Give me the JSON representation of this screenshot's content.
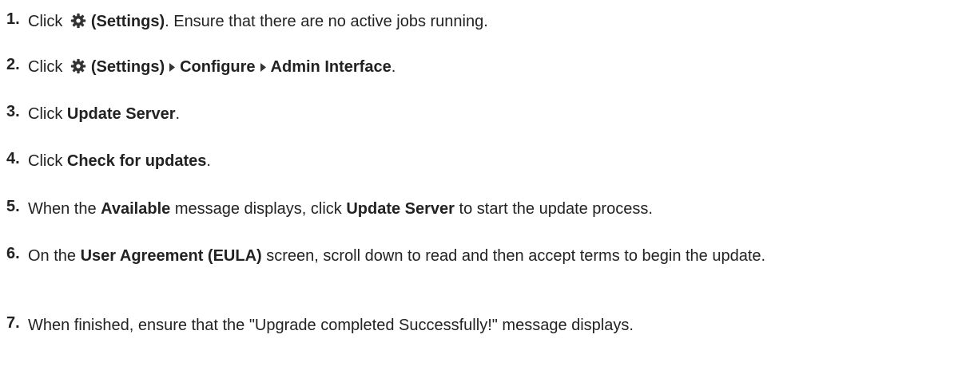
{
  "steps": [
    {
      "number": "1.",
      "runs": [
        {
          "t": "Click ",
          "b": false
        },
        {
          "icon": "gear-icon"
        },
        {
          "t": "(Settings)",
          "b": true
        },
        {
          "t": ". Ensure that there are no active jobs running.",
          "b": false
        }
      ]
    },
    {
      "number": "2.",
      "runs": [
        {
          "t": "Click ",
          "b": false
        },
        {
          "icon": "gear-icon"
        },
        {
          "t": "(Settings)",
          "b": true
        },
        {
          "icon": "caret-right-icon"
        },
        {
          "t": "Configure",
          "b": true
        },
        {
          "icon": "caret-right-icon"
        },
        {
          "t": "Admin Interface",
          "b": true
        },
        {
          "t": ".",
          "b": false
        }
      ]
    },
    {
      "number": "3.",
      "runs": [
        {
          "t": "Click ",
          "b": false
        },
        {
          "t": "Update Server",
          "b": true
        },
        {
          "t": ".",
          "b": false
        }
      ]
    },
    {
      "number": "4.",
      "runs": [
        {
          "t": "Click ",
          "b": false
        },
        {
          "t": "Check for updates",
          "b": true
        },
        {
          "t": ".",
          "b": false
        }
      ]
    },
    {
      "number": "5.",
      "runs": [
        {
          "t": "When the ",
          "b": false
        },
        {
          "t": "Available",
          "b": true
        },
        {
          "t": " message displays, click ",
          "b": false
        },
        {
          "t": "Update Server",
          "b": true
        },
        {
          "t": " to start the update process.",
          "b": false
        }
      ]
    },
    {
      "number": "6.",
      "runs": [
        {
          "t": "On the ",
          "b": false
        },
        {
          "t": "User Agreement (EULA)",
          "b": true
        },
        {
          "t": " screen, scroll down to read and then accept terms to begin the update.",
          "b": false
        }
      ]
    },
    {
      "number": "7.",
      "runs": [
        {
          "t": "When finished, ensure that the \"Upgrade completed Successfully!\" message displays.",
          "b": false
        }
      ]
    }
  ],
  "colors": {
    "text": "#222222",
    "icon": "#333333",
    "background": "#ffffff"
  }
}
